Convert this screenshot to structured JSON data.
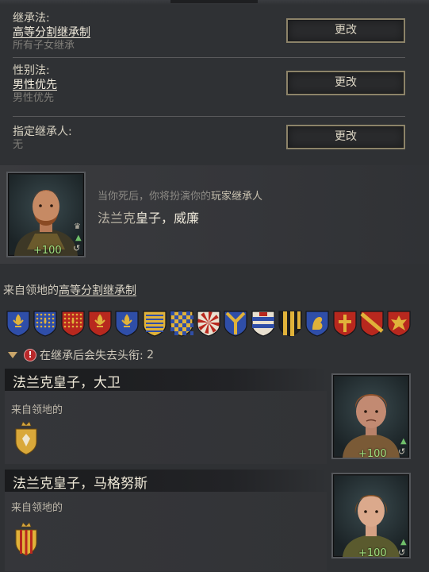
{
  "succession": {
    "label": "继承法:",
    "value": "高等分割继承制",
    "sub": "所有子女继承",
    "button": "更改"
  },
  "gender": {
    "label": "性别法:",
    "value": "男性优先",
    "sub": "男性优先",
    "button": "更改"
  },
  "designated": {
    "label": "指定继承人:",
    "value": "无",
    "button": "更改"
  },
  "heir": {
    "intro_a": "当你死后，你将扮演你的",
    "intro_b": "玩家继承人",
    "title_prefix": "法兰克",
    "name": "皇子，威廉",
    "score": "+100"
  },
  "domain_line": {
    "prefix": "来自领地的",
    "link": "高等分割继承制"
  },
  "titles_lost": {
    "text": "在继承后会失去头衔:",
    "count": "2"
  },
  "children": [
    {
      "name": "法兰克皇子，大卫",
      "from": "来自领地的",
      "score": "+100"
    },
    {
      "name": "法兰克皇子，马格努斯",
      "from": "来自领地的",
      "score": "+100"
    }
  ],
  "colors": {
    "accent_gold": "#8c8369",
    "score_green": "#9fe07f",
    "warning_red": "#b8282a"
  },
  "icons": [
    "crown-icon",
    "drop-icon",
    "swirl-icon",
    "warning-icon",
    "triangle-down-icon",
    "coat-of-arms-icon"
  ]
}
